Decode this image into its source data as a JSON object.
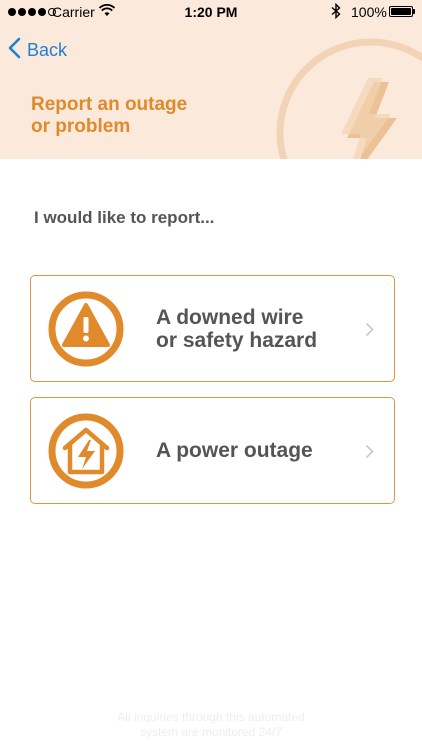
{
  "status_bar": {
    "carrier": "Carrier",
    "time": "1:20 PM",
    "battery": "100%",
    "signal_bars": 4
  },
  "nav": {
    "back_label": "Back"
  },
  "header": {
    "title_line1": "Report an outage",
    "title_line2": "or problem"
  },
  "prompt": "I would like to report...",
  "options": [
    {
      "line1": "A downed wire",
      "line2": "or safety hazard",
      "icon": "warning-icon"
    },
    {
      "line1": "A power outage",
      "line2": "",
      "icon": "house-bolt-icon"
    }
  ],
  "footer": {
    "line1": "All inquiries through this automated",
    "line2": "system are monitored 24/7"
  },
  "colors": {
    "accent": "#e08a2b",
    "header_bg": "#fbe9dc",
    "link": "#1f7fd1",
    "text": "#555555"
  }
}
